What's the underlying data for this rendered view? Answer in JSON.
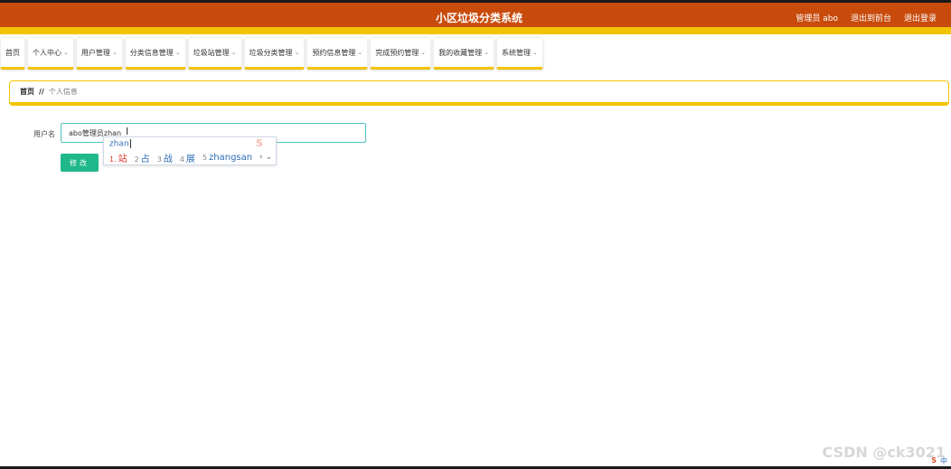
{
  "header": {
    "title": "小区垃圾分类系统",
    "links": [
      "管理员 abo",
      "退出到前台",
      "退出登录"
    ]
  },
  "nav": {
    "items": [
      {
        "label": "首页",
        "dropdown": false
      },
      {
        "label": "个人中心",
        "dropdown": true
      },
      {
        "label": "用户管理",
        "dropdown": true
      },
      {
        "label": "分类信息管理",
        "dropdown": true
      },
      {
        "label": "垃圾站管理",
        "dropdown": true
      },
      {
        "label": "垃圾分类管理",
        "dropdown": true
      },
      {
        "label": "预约信息管理",
        "dropdown": true
      },
      {
        "label": "完成预约管理",
        "dropdown": true
      },
      {
        "label": "我的收藏管理",
        "dropdown": true
      },
      {
        "label": "系统管理",
        "dropdown": true
      }
    ]
  },
  "breadcrumb": {
    "home": "首页",
    "separator": "//",
    "current": "个人信息"
  },
  "form": {
    "username_label": "用户名",
    "username_value": "abo管理员",
    "username_composing": "zhan",
    "submit_label": "修改"
  },
  "ime": {
    "composition": "zhan",
    "candidates": [
      {
        "num": "1.",
        "text": "站"
      },
      {
        "num": "2",
        "text": "占"
      },
      {
        "num": "3",
        "text": "战"
      },
      {
        "num": "4",
        "text": "展"
      },
      {
        "num": "5",
        "text": "zhangsan"
      }
    ],
    "more": "› ⌄"
  },
  "watermark": "CSDN @ck3021",
  "tray": {
    "s_icon": "S",
    "lang": "中"
  },
  "colors": {
    "header_bg": "#c84b0c",
    "accent_yellow": "#f2c400",
    "submit_bg": "#1fb88a",
    "input_border": "#4fc3c3"
  }
}
